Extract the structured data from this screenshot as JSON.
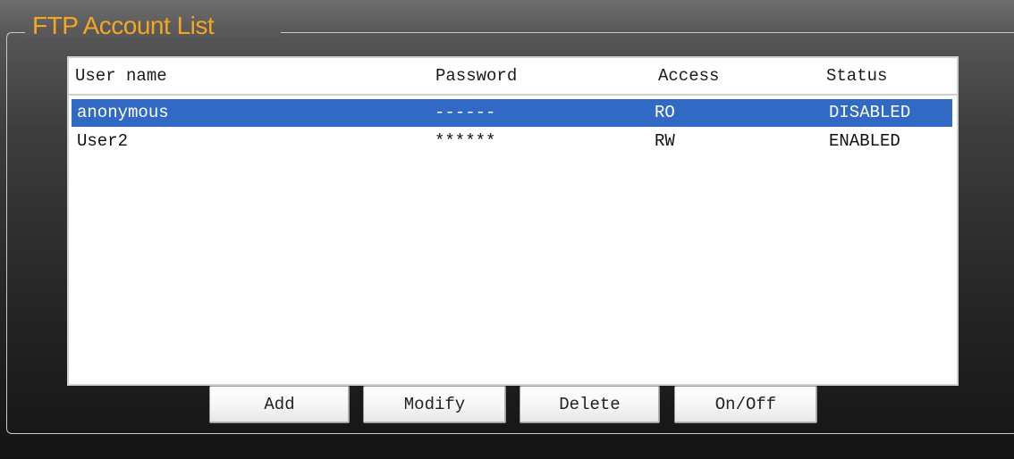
{
  "panel": {
    "title": "FTP Account List"
  },
  "table": {
    "columns": [
      "User name",
      "Password",
      "Access",
      "Status"
    ],
    "rows": [
      {
        "user": "anonymous",
        "password": "------",
        "access": "RO",
        "status": "DISABLED",
        "selected": true
      },
      {
        "user": "User2",
        "password": "******",
        "access": "RW",
        "status": "ENABLED",
        "selected": false
      }
    ]
  },
  "buttons": {
    "add": "Add",
    "modify": "Modify",
    "delete": "Delete",
    "onoff": "On/Off"
  },
  "colors": {
    "title": "#f5a623",
    "selection": "#316ac5"
  }
}
